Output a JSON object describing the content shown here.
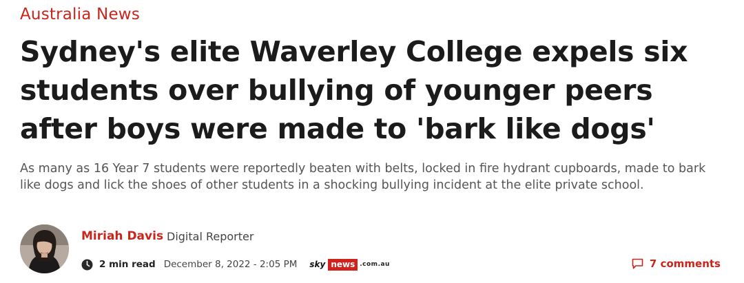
{
  "section": {
    "label": "Australia News"
  },
  "article": {
    "headline_lines": [
      "Sydney's elite Waverley College expels six",
      "students over bullying of younger peers",
      "after boys were made to 'bark like dogs'"
    ],
    "standfirst": "As many as 16 Year 7 students were reportedly beaten with belts, locked in fire hydrant cupboards, made to bark like dogs and lick the shoes of other students in a shocking bullying incident at the elite private school."
  },
  "author": {
    "name": "Miriah Davis",
    "role": "Digital Reporter",
    "avatar_icon": "author-photo"
  },
  "meta": {
    "read_time": "2 min read",
    "date": "December 8, 2022 - 2:05 PM",
    "clock_icon": "clock-icon",
    "brand": {
      "sky": "sky",
      "news": "news",
      "domain": ".com.au",
      "color": "#d0211c"
    }
  },
  "comments": {
    "label": "7 comments",
    "icon": "comment-icon"
  },
  "colors": {
    "accent": "#c8251d",
    "headline": "#1b1b1b",
    "standfirst": "#555555"
  }
}
